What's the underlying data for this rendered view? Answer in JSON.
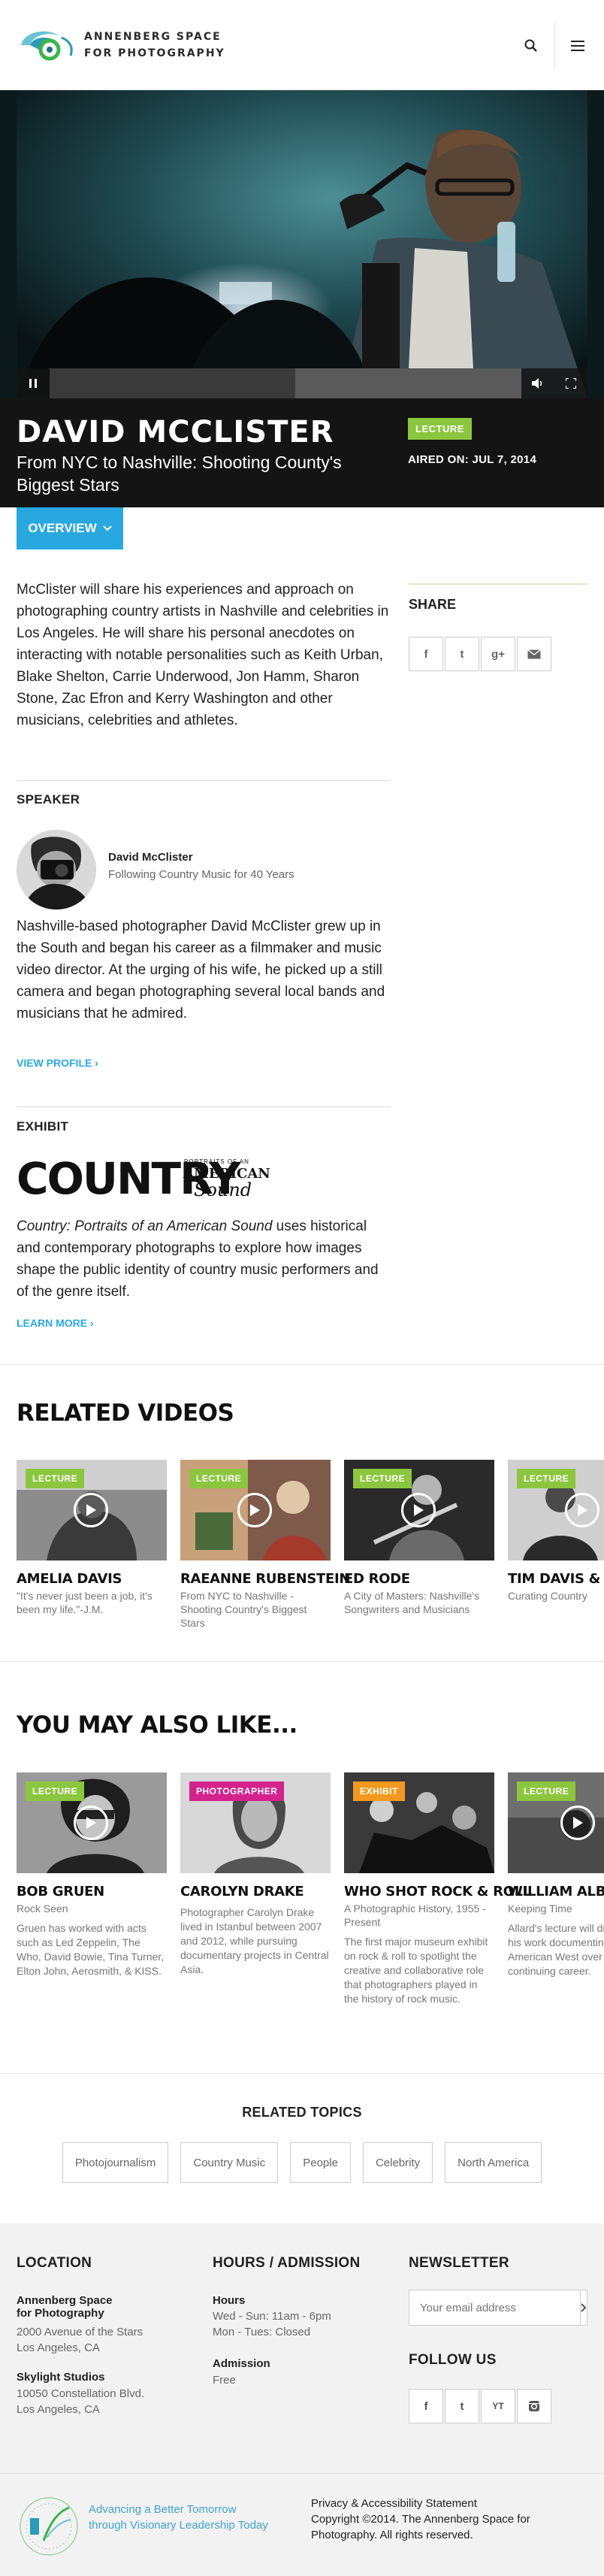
{
  "header": {
    "logo_line1": "ANNENBERG SPACE",
    "logo_line2": "FOR PHOTOGRAPHY",
    "search_icon": "search-icon",
    "menu_icon": "hamburger-menu-icon"
  },
  "hero": {
    "progress": 0.52,
    "controls": [
      "pause-icon",
      "volume-icon",
      "fullscreen-icon"
    ]
  },
  "title": {
    "name": "DAVID MCCLISTER",
    "subtitle": "From NYC to Nashville: Shooting County's Biggest Stars",
    "badge": "LECTURE",
    "aired": "AIRED ON: JUL 7, 2014"
  },
  "overview_tab": "OVERVIEW",
  "main": {
    "intro": "McClister will share his experiences and approach on photographing country artists in Nashville and celebrities in Los Angeles. He will share his personal anecdotes on interacting with notable personalities such as Keith Urban, Blake Shelton, Carrie Underwood, Jon Hamm, Sharon Stone, Zac Efron and Kerry Washington and other musicians, celebrities and athletes.",
    "speaker_heading": "SPEAKER",
    "speaker_name": "David McClister",
    "speaker_role": "Following Country Music for 40 Years",
    "speaker_bio": "Nashville-based photographer David McClister grew up in the South and began his career as a filmmaker and music video director. At the urging of his wife, he picked up a still camera and began photographing several local bands and musicians that he admired.",
    "view_profile": "VIEW PROFILE",
    "exhibit_heading": "EXHIBIT",
    "exhibit_logo_word": "COUNTRY",
    "exhibit_logo_small": "PORTRAITS OF AN",
    "exhibit_logo_american": "AMERICAN",
    "exhibit_logo_sound": "Sound",
    "exhibit_title": "Country: Portraits of an American Sound",
    "exhibit_desc": " uses historical and contemporary photographs to explore how images shape the public identity of country music performers and of the genre itself.",
    "learn_more": "LEARN MORE"
  },
  "share": {
    "heading": "SHARE",
    "buttons": [
      "f",
      "t",
      "g+",
      "mail"
    ]
  },
  "related_videos": {
    "heading": "RELATED VIDEOS",
    "items": [
      {
        "badge": "LECTURE",
        "title": "AMELIA DAVIS",
        "sub": "\"It's never just been a job, it's been my life.\"-J.M."
      },
      {
        "badge": "LECTURE",
        "title": "RAEANNE RUBENSTEIN",
        "sub": "From NYC to Nashville - Shooting Country's Biggest Stars"
      },
      {
        "badge": "LECTURE",
        "title": "ED RODE",
        "sub": "A City of Masters: Nashville's Songwriters and Musicians"
      },
      {
        "badge": "LECTURE",
        "title": "TIM DAVIS & MIC",
        "sub": "Curating Country"
      }
    ]
  },
  "also_like": {
    "heading": "YOU MAY ALSO LIKE...",
    "items": [
      {
        "badge": "LECTURE",
        "title": "BOB GRUEN",
        "sub": "Rock Seen",
        "desc": "Gruen has worked with acts such as Led Zeppelin, The Who, David Bowie, Tina Turner, Elton John, Aerosmith, & KISS."
      },
      {
        "badge": "PHOTOGRAPHER",
        "title": "CAROLYN DRAKE",
        "sub": "",
        "desc": "Photographer Carolyn Drake lived in Istanbul between 2007 and 2012, while pursuing documentary projects in Central Asia."
      },
      {
        "badge": "EXHIBIT",
        "title": "WHO SHOT ROCK & ROLL",
        "sub": "A Photographic History, 1955 - Present",
        "desc": "The first major museum exhibit on rock & roll to spotlight the creative and collaborative role that photographers played in the history of rock music."
      },
      {
        "badge": "LECTURE",
        "title": "WILLIAM ALBERT",
        "sub": "Keeping Time",
        "desc": "Allard's lecture will draw upon his work documenting the American West over a continuing career."
      }
    ]
  },
  "topics": {
    "heading": "RELATED TOPICS",
    "items": [
      "Photojournalism",
      "Country Music",
      "People",
      "Celebrity",
      "North America"
    ]
  },
  "footer": {
    "location_heading": "LOCATION",
    "venue1_name_l1": "Annenberg Space",
    "venue1_name_l2": "for Photography",
    "venue1_addr_l1": "2000 Avenue of the Stars",
    "venue1_addr_l2": "Los Angeles, CA",
    "venue2_name": "Skylight Studios",
    "venue2_addr_l1": "10050 Constellation Blvd.",
    "venue2_addr_l2": "Los Angeles, CA",
    "hours_heading": "HOURS / ADMISSION",
    "hours_label": "Hours",
    "hours_l1": "Wed - Sun: 11am - 6pm",
    "hours_l2": "Mon - Tues: Closed",
    "admission_label": "Admission",
    "admission_value": "Free",
    "newsletter_heading": "NEWSLETTER",
    "newsletter_placeholder": "Your email address",
    "follow_heading": "FOLLOW US",
    "follow_buttons": [
      "f",
      "t",
      "YT",
      "ig"
    ],
    "tagline_l1": "Advancing a Better Tomorrow",
    "tagline_l2": "through Visionary Leadership Today",
    "privacy": "Privacy & Accessibility Statement",
    "copyright": "Copyright ©2014. The Annenberg Space for Photography. All rights reserved."
  },
  "colors": {
    "accent_blue": "#29a8e0",
    "lecture_green": "#8cc63f",
    "photographer_magenta": "#d4238c",
    "exhibit_orange": "#f29a1f"
  }
}
